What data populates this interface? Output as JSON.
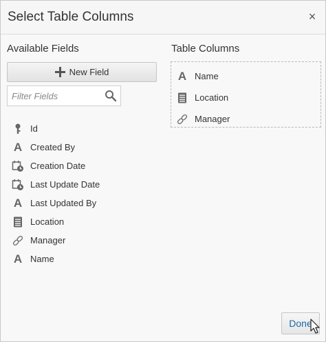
{
  "dialog": {
    "title": "Select Table Columns",
    "close_label": "×"
  },
  "available": {
    "heading": "Available Fields",
    "new_field_label": "New Field",
    "filter_placeholder": "Filter Fields",
    "fields": [
      {
        "label": "Id",
        "icon": "key-icon"
      },
      {
        "label": "Created By",
        "icon": "text-a-icon"
      },
      {
        "label": "Creation Date",
        "icon": "calendar-clock-icon"
      },
      {
        "label": "Last Update Date",
        "icon": "calendar-clock-icon"
      },
      {
        "label": "Last Updated By",
        "icon": "text-a-icon"
      },
      {
        "label": "Location",
        "icon": "document-list-icon"
      },
      {
        "label": "Manager",
        "icon": "link-icon"
      },
      {
        "label": "Name",
        "icon": "text-a-icon"
      }
    ]
  },
  "table_columns": {
    "heading": "Table Columns",
    "columns": [
      {
        "label": "Name",
        "icon": "text-a-icon"
      },
      {
        "label": "Location",
        "icon": "document-list-icon"
      },
      {
        "label": "Manager",
        "icon": "link-icon"
      }
    ]
  },
  "footer": {
    "done_label": "Done"
  },
  "colors": {
    "accent_text": "#1a6aa8",
    "icon_gray": "#666666"
  }
}
